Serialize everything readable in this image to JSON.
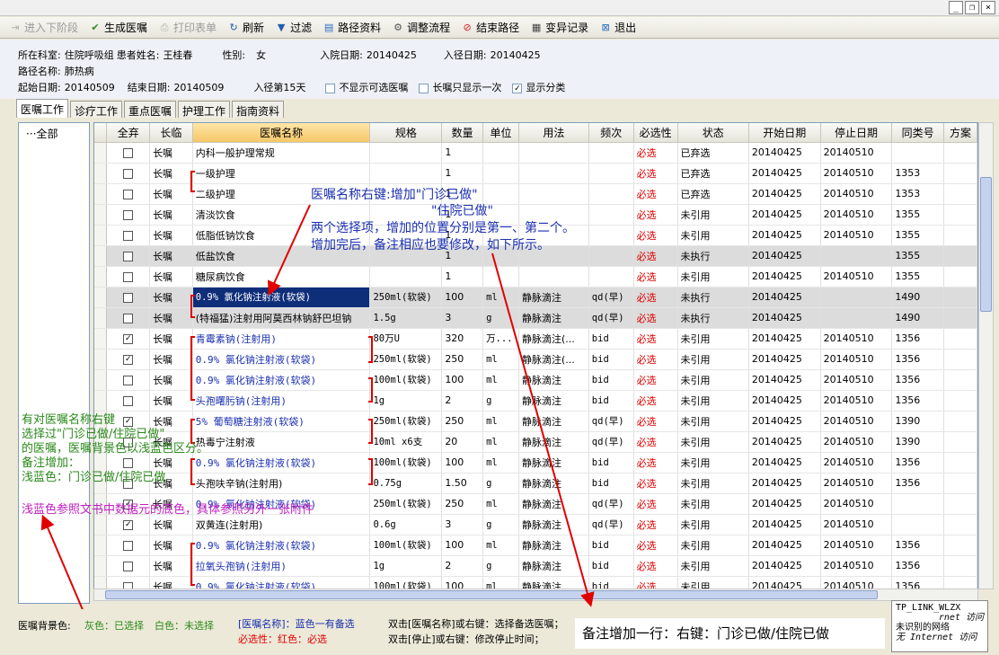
{
  "window": {
    "min": "_",
    "max": "❐",
    "close": "×"
  },
  "toolbar": [
    {
      "label": "进入下阶段",
      "icon": "next-stage-icon",
      "disabled": true,
      "glyph": "⇥",
      "color": "#b0b0b0"
    },
    {
      "label": "生成医嘱",
      "icon": "check-icon",
      "disabled": false,
      "glyph": "✔",
      "color": "#2b8a2b"
    },
    {
      "label": "打印表单",
      "icon": "printer-icon",
      "disabled": true,
      "glyph": "⎙",
      "color": "#b0b0b0"
    },
    {
      "label": "刷新",
      "icon": "refresh-icon",
      "disabled": false,
      "glyph": "↻",
      "color": "#1f5fae"
    },
    {
      "label": "过滤",
      "icon": "filter-icon",
      "disabled": false,
      "glyph": "▼",
      "color": "#1f5fae"
    },
    {
      "label": "路径资料",
      "icon": "document-icon",
      "disabled": false,
      "glyph": "▤",
      "color": "#2a6cc4"
    },
    {
      "label": "调整流程",
      "icon": "gear-icon",
      "disabled": false,
      "glyph": "⚙",
      "color": "#555"
    },
    {
      "label": "结束路径",
      "icon": "stop-icon",
      "disabled": false,
      "glyph": "⊘",
      "color": "#d02020"
    },
    {
      "label": "变异记录",
      "icon": "calculator-icon",
      "disabled": false,
      "glyph": "▦",
      "color": "#444"
    },
    {
      "label": "退出",
      "icon": "exit-icon",
      "disabled": false,
      "glyph": "⊠",
      "color": "#2a6cc4"
    }
  ],
  "patient": {
    "dept_label": "所在科室:",
    "dept": "住院呼吸组",
    "name_label": "患者姓名:",
    "name": "王桂春",
    "sex_label": "性别:",
    "sex": "女",
    "admit_label": "入院日期:",
    "admit": "20140425",
    "path_in_label": "入径日期:",
    "path_in": "20140425",
    "path_label": "路径名称:",
    "path": "肺热病",
    "start_label": "起始日期:",
    "start": "20140509",
    "end_label": "结束日期:",
    "end": "20140509",
    "day": "入径第15天",
    "opt1": "不显示可选医嘱",
    "opt1_checked": false,
    "opt2": "长嘱只显示一次",
    "opt2_checked": false,
    "opt3": "显示分类",
    "opt3_checked": true
  },
  "tabs": [
    "医嘱工作",
    "诊疗工作",
    "重点医嘱",
    "护理工作",
    "指南资料"
  ],
  "tree": {
    "root": "全部"
  },
  "columns": [
    "",
    "全弃",
    "长临",
    "医嘱名称",
    "规格",
    "数量",
    "单位",
    "用法",
    "频次",
    "必选性",
    "状态",
    "开始日期",
    "停止日期",
    "同类号",
    "方案"
  ],
  "rows": [
    {
      "chk": false,
      "type": "长嘱",
      "name": "内科一般护理常规",
      "spec": "",
      "qty": "1",
      "unit": "",
      "usage": "",
      "freq": "",
      "req": "必选",
      "status": "已弃选",
      "start": "20140425",
      "stop": "20140510",
      "grp": "",
      "gray": false,
      "blue": false
    },
    {
      "chk": false,
      "type": "长嘱",
      "name": "一级护理",
      "spec": "",
      "qty": "1",
      "unit": "",
      "usage": "",
      "freq": "",
      "req": "必选",
      "status": "已弃选",
      "start": "20140425",
      "stop": "20140510",
      "grp": "1353",
      "gray": false,
      "blue": false
    },
    {
      "chk": false,
      "type": "长嘱",
      "name": "二级护理",
      "spec": "",
      "qty": "1",
      "unit": "",
      "usage": "",
      "freq": "",
      "req": "必选",
      "status": "已弃选",
      "start": "20140425",
      "stop": "20140510",
      "grp": "1353",
      "gray": false,
      "blue": false
    },
    {
      "chk": false,
      "type": "长嘱",
      "name": "清淡饮食",
      "spec": "",
      "qty": "1",
      "unit": "",
      "usage": "",
      "freq": "",
      "req": "必选",
      "status": "未引用",
      "start": "20140425",
      "stop": "20140510",
      "grp": "1355",
      "gray": false,
      "blue": false
    },
    {
      "chk": false,
      "type": "长嘱",
      "name": "低脂低钠饮食",
      "spec": "",
      "qty": "1",
      "unit": "",
      "usage": "",
      "freq": "",
      "req": "必选",
      "status": "未引用",
      "start": "20140425",
      "stop": "20140510",
      "grp": "1355",
      "gray": false,
      "blue": false
    },
    {
      "chk": false,
      "type": "长嘱",
      "name": "低盐饮食",
      "spec": "",
      "qty": "1",
      "unit": "",
      "usage": "",
      "freq": "",
      "req": "必选",
      "status": "未执行",
      "start": "20140425",
      "stop": "",
      "grp": "1355",
      "gray": true,
      "blue": false
    },
    {
      "chk": false,
      "type": "长嘱",
      "name": "糖尿病饮食",
      "spec": "",
      "qty": "1",
      "unit": "",
      "usage": "",
      "freq": "",
      "req": "必选",
      "status": "未引用",
      "start": "20140425",
      "stop": "20140510",
      "grp": "1355",
      "gray": false,
      "blue": false
    },
    {
      "chk": false,
      "type": "长嘱",
      "name": "0.9% 氯化钠注射液(软袋)",
      "spec": "250ml(软袋)",
      "qty": "100",
      "unit": "ml",
      "usage": "静脉滴注",
      "freq": "qd(早)",
      "req": "必选",
      "status": "未执行",
      "start": "20140425",
      "stop": "",
      "grp": "1490",
      "gray": true,
      "blue": false,
      "selected": true
    },
    {
      "chk": false,
      "type": "长嘱",
      "name": "(特福猛)注射用阿莫西林钠舒巴坦钠",
      "spec": "1.5g",
      "qty": "3",
      "unit": "g",
      "usage": "静脉滴注",
      "freq": "qd(早)",
      "req": "必选",
      "status": "未执行",
      "start": "20140425",
      "stop": "",
      "grp": "1490",
      "gray": true,
      "blue": false
    },
    {
      "chk": true,
      "type": "长嘱",
      "name": "青霉素钠(注射用)",
      "spec": "80万U",
      "qty": "320",
      "unit": "万...",
      "usage": "静脉滴注(...",
      "freq": "bid",
      "req": "必选",
      "status": "未引用",
      "start": "20140425",
      "stop": "20140510",
      "grp": "1356",
      "gray": false,
      "blue": true
    },
    {
      "chk": true,
      "type": "长嘱",
      "name": "0.9% 氯化钠注射液(软袋)",
      "spec": "250ml(软袋)",
      "qty": "250",
      "unit": "ml",
      "usage": "静脉滴注(...",
      "freq": "bid",
      "req": "必选",
      "status": "未引用",
      "start": "20140425",
      "stop": "20140510",
      "grp": "1356",
      "gray": false,
      "blue": true
    },
    {
      "chk": false,
      "type": "长嘱",
      "name": "0.9% 氯化钠注射液(软袋)",
      "spec": "100ml(软袋)",
      "qty": "100",
      "unit": "ml",
      "usage": "静脉滴注",
      "freq": "bid",
      "req": "必选",
      "status": "未引用",
      "start": "20140425",
      "stop": "20140510",
      "grp": "1356",
      "gray": false,
      "blue": true
    },
    {
      "chk": false,
      "type": "长嘱",
      "name": "头孢曙肟钠(注射用)",
      "spec": "1g",
      "qty": "2",
      "unit": "g",
      "usage": "静脉滴注",
      "freq": "bid",
      "req": "必选",
      "status": "未引用",
      "start": "20140425",
      "stop": "20140510",
      "grp": "1356",
      "gray": false,
      "blue": true
    },
    {
      "chk": true,
      "type": "长嘱",
      "name": "5% 葡萄糖注射液(软袋)",
      "spec": "250ml(软袋)",
      "qty": "250",
      "unit": "ml",
      "usage": "静脉滴注",
      "freq": "qd(早)",
      "req": "必选",
      "status": "未引用",
      "start": "20140425",
      "stop": "20140510",
      "grp": "1390",
      "gray": false,
      "blue": true
    },
    {
      "chk": false,
      "type": "长嘱",
      "name": "热毒宁注射液",
      "spec": "10ml x6支",
      "qty": "20",
      "unit": "ml",
      "usage": "静脉滴注",
      "freq": "qd(早)",
      "req": "必选",
      "status": "未引用",
      "start": "20140425",
      "stop": "20140510",
      "grp": "1390",
      "gray": false,
      "blue": false
    },
    {
      "chk": false,
      "type": "长嘱",
      "name": "0.9% 氯化钠注射液(软袋)",
      "spec": "100ml(软袋)",
      "qty": "100",
      "unit": "ml",
      "usage": "静脉滴注",
      "freq": "bid",
      "req": "必选",
      "status": "未引用",
      "start": "20140425",
      "stop": "20140510",
      "grp": "1356",
      "gray": false,
      "blue": true
    },
    {
      "chk": false,
      "type": "长嘱",
      "name": "头孢呋辛钠(注射用)",
      "spec": "0.75g",
      "qty": "1.50",
      "unit": "g",
      "usage": "静脉滴注",
      "freq": "bid",
      "req": "必选",
      "status": "未引用",
      "start": "20140425",
      "stop": "20140510",
      "grp": "1356",
      "gray": false,
      "blue": false
    },
    {
      "chk": true,
      "type": "长嘱",
      "name": "0.9% 氯化钠注射液(软袋)",
      "spec": "250ml(软袋)",
      "qty": "250",
      "unit": "ml",
      "usage": "静脉滴注",
      "freq": "qd(早)",
      "req": "必选",
      "status": "未引用",
      "start": "20140425",
      "stop": "20140510",
      "grp": "",
      "gray": false,
      "blue": true
    },
    {
      "chk": true,
      "type": "长嘱",
      "name": "双黄连(注射用)",
      "spec": "0.6g",
      "qty": "3",
      "unit": "g",
      "usage": "静脉滴注",
      "freq": "qd(早)",
      "req": "必选",
      "status": "未引用",
      "start": "20140425",
      "stop": "20140510",
      "grp": "",
      "gray": false,
      "blue": false
    },
    {
      "chk": false,
      "type": "长嘱",
      "name": "0.9% 氯化钠注射液(软袋)",
      "spec": "100ml(软袋)",
      "qty": "100",
      "unit": "ml",
      "usage": "静脉滴注",
      "freq": "bid",
      "req": "必选",
      "status": "未引用",
      "start": "20140425",
      "stop": "20140510",
      "grp": "1356",
      "gray": false,
      "blue": true
    },
    {
      "chk": false,
      "type": "长嘱",
      "name": "拉氧头孢钠(注射用)",
      "spec": "1g",
      "qty": "2",
      "unit": "g",
      "usage": "静脉滴注",
      "freq": "bid",
      "req": "必选",
      "status": "未引用",
      "start": "20140425",
      "stop": "20140510",
      "grp": "1356",
      "gray": false,
      "blue": true
    },
    {
      "chk": false,
      "type": "长嘱",
      "name": "0.9% 氯化钠注射液(软袋)",
      "spec": "100ml(软袋)",
      "qty": "100",
      "unit": "ml",
      "usage": "静脉滴注",
      "freq": "bid",
      "req": "必选",
      "status": "未引用",
      "start": "20140425",
      "stop": "20140510",
      "grp": "1356",
      "gray": false,
      "blue": true
    }
  ],
  "annotations": {
    "a1": "医嘱名称右键:增加\"门诊已做\"",
    "a2": "\"住院已做\"",
    "a3": "两个选择项，增加的位置分别是第一、第二个。",
    "a4": "增加完后，备注相应也要修改，如下所示。",
    "g1": "有对医嘱名称右键",
    "g2": "选择过\"门诊已做/住院已做\"",
    "g3": "的医嘱，医嘱背景色以浅蓝色区分。",
    "g4": "备注增加：",
    "g5": "浅蓝色：门诊已做/住院已做",
    "m1": "浅蓝色参照文书中数据元的底色，具体参照另外一张附件"
  },
  "legend": {
    "bg_label": "医嘱背景色:",
    "bg_gray": "灰色：已选择",
    "bg_white": "白色：未选择",
    "name_label": "[医嘱名称]：蓝色一有备选",
    "req_label": "必选性：红色：必选",
    "tip1": "双击[医嘱名称]或右键：选择备选医嘱；",
    "tip2": "双击[停止]或右键：修改停止时间；"
  },
  "note_box": "备注增加一行：右键：门诊已做/住院已做",
  "net": {
    "l1": "TP_LINK_WLZX",
    "l2": "rnet 访问",
    "l3": "未识别的网络",
    "l4": "无 Internet 访问"
  },
  "colors": {
    "selected": "#0f2e7a",
    "required": "#e00000",
    "blue_text": "#1a2fb0",
    "gray_row": "#dcdcdc",
    "annotation_blue": "#1a2fb0",
    "annotation_green": "#2a8a1a",
    "annotation_magenta": "#c020c0"
  }
}
